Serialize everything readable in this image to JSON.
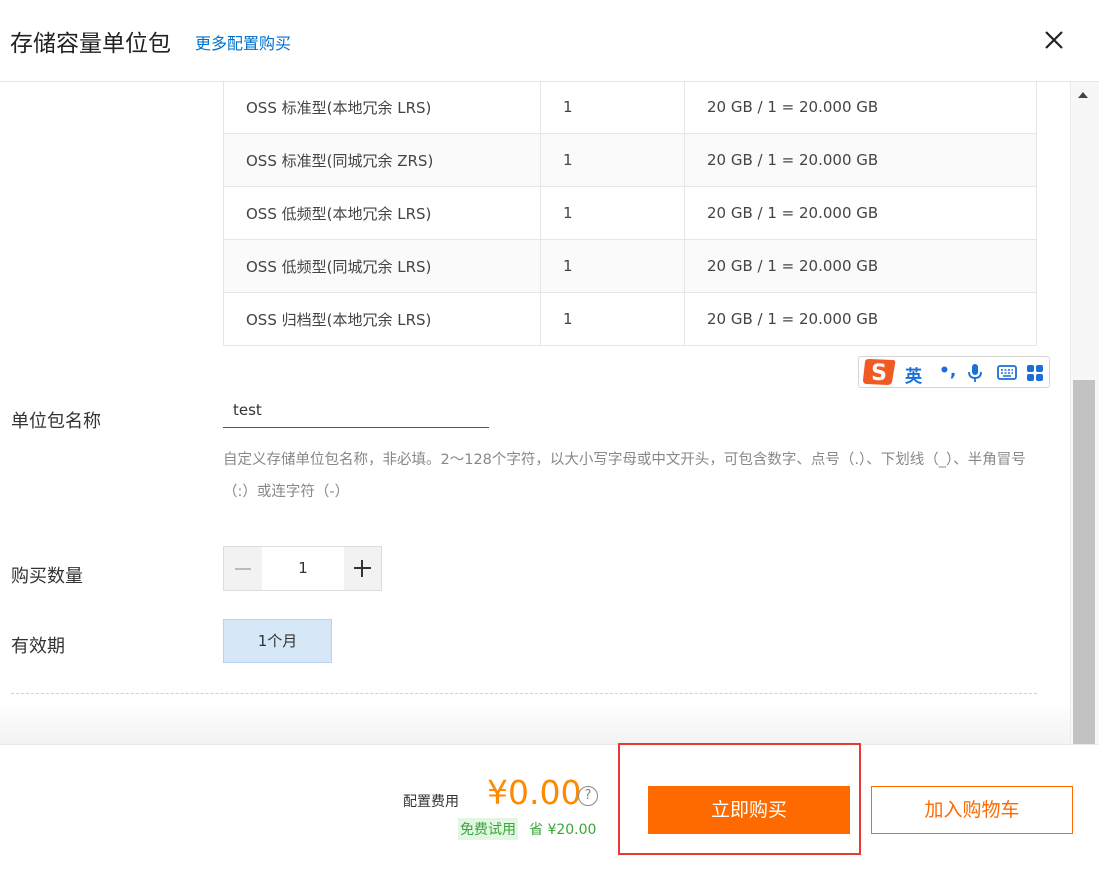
{
  "header": {
    "title": "存储容量单位包",
    "more_link": "更多配置购买"
  },
  "table": {
    "rows": [
      {
        "type": "OSS 标准型(本地冗余 LRS)",
        "count": "1",
        "capacity": "20 GB / 1 = 20.000 GB"
      },
      {
        "type": "OSS 标准型(同城冗余 ZRS)",
        "count": "1",
        "capacity": "20 GB / 1 = 20.000 GB"
      },
      {
        "type": "OSS 低频型(本地冗余 LRS)",
        "count": "1",
        "capacity": "20 GB / 1 = 20.000 GB"
      },
      {
        "type": "OSS 低频型(同城冗余 LRS)",
        "count": "1",
        "capacity": "20 GB / 1 = 20.000 GB"
      },
      {
        "type": "OSS 归档型(本地冗余 LRS)",
        "count": "1",
        "capacity": "20 GB / 1 = 20.000 GB"
      }
    ]
  },
  "ime_toolbar": {
    "mode": "英",
    "punct": "•,",
    "icons": [
      "sogou-logo-icon",
      "microphone-icon",
      "keyboard-icon",
      "grid-icon"
    ]
  },
  "form": {
    "name_label": "单位包名称",
    "name_value": "test",
    "name_hint": "自定义存储单位包名称，非必填。2～128个字符，以大小写字母或中文开头，可包含数字、点号（.）、下划线（_）、半角冒号（:）或连字符（-）",
    "quantity_label": "购买数量",
    "quantity_value": "1",
    "period_label": "有效期",
    "period_option": "1个月"
  },
  "footer": {
    "fee_label": "配置费用",
    "fee_value": "¥0.00",
    "help_symbol": "?",
    "trial_badge": "免费试用",
    "save_text": "省 ¥20.00",
    "buy_now": "立即购买",
    "add_to_cart": "加入购物车"
  },
  "colors": {
    "accent": "#ff6a00",
    "price": "#ff8a00",
    "link": "#0070cc",
    "success": "#3aa63a",
    "highlight": "#e53935"
  }
}
